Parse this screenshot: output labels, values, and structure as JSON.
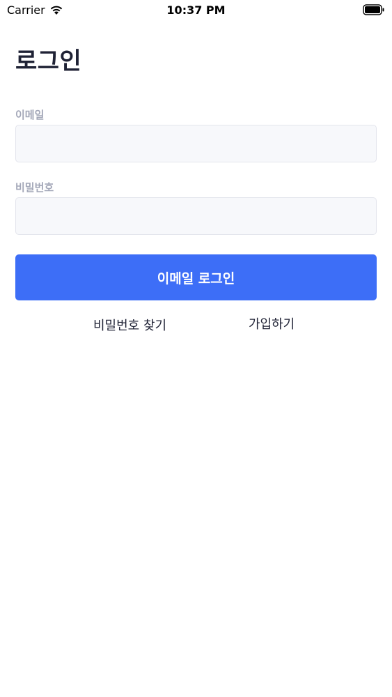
{
  "status_bar": {
    "carrier": "Carrier",
    "time": "10:37 PM",
    "icons": [
      "wifi-icon",
      "battery-icon"
    ]
  },
  "login": {
    "title": "로그인",
    "email_label": "이메일",
    "email_value": "",
    "password_label": "비밀번호",
    "password_value": "",
    "submit_label": "이메일 로그인",
    "find_password_label": "비밀번호 찾기",
    "signup_label": "가입하기"
  },
  "colors": {
    "accent": "#3d6ef7",
    "title_text": "#1f2235",
    "label_text": "#a3a7b8",
    "input_background": "#f7f8fb",
    "input_border": "#e3e5ec"
  }
}
